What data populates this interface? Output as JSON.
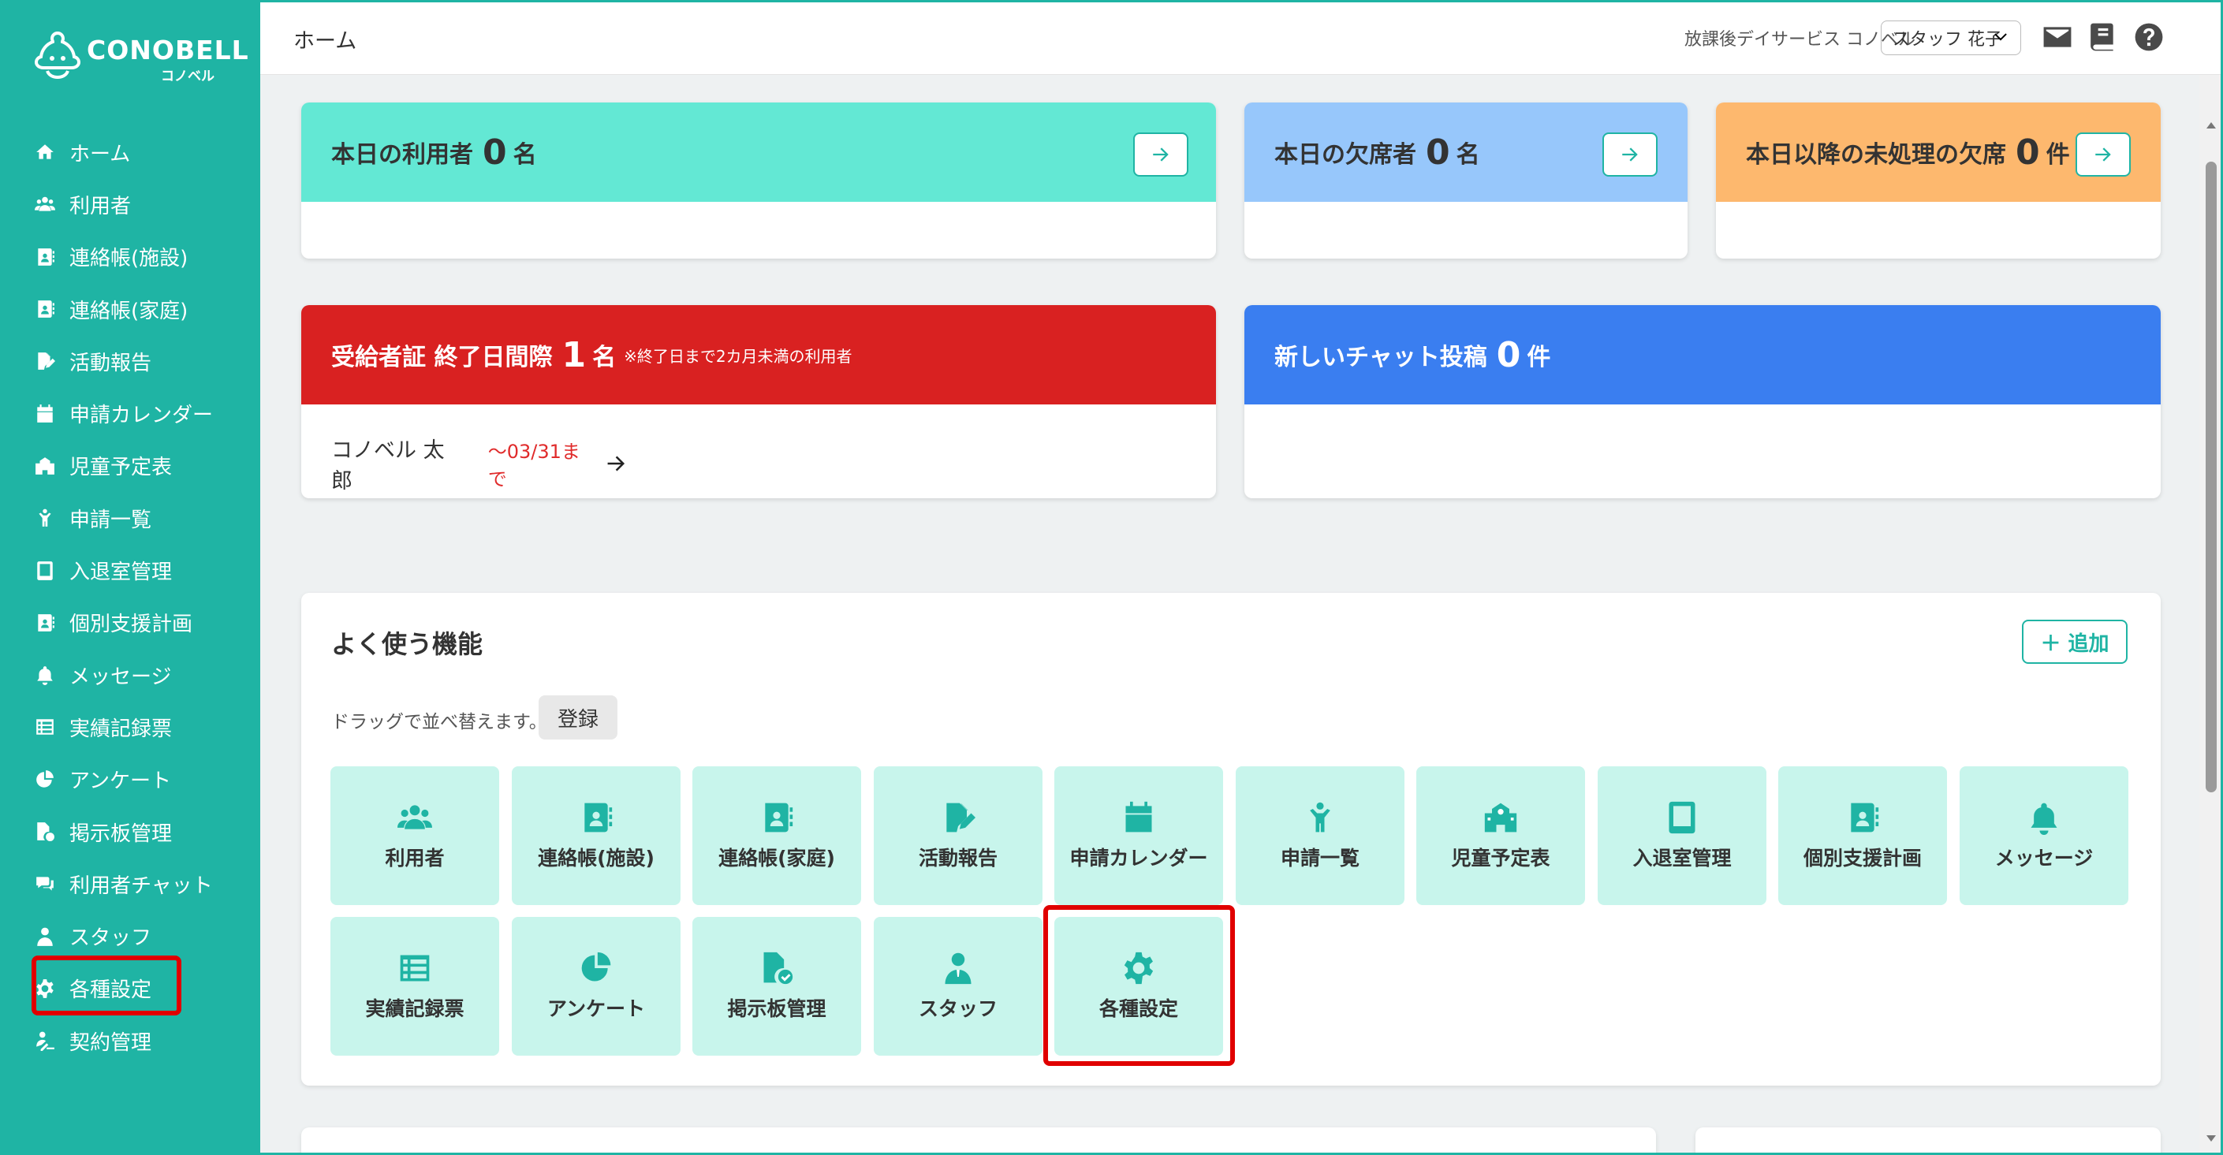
{
  "app": {
    "logo_text": "CONOBELL",
    "logo_sub": "コノベル"
  },
  "sidebar": {
    "items": [
      {
        "label": "ホーム",
        "icon": "home-icon"
      },
      {
        "label": "利用者",
        "icon": "users-icon"
      },
      {
        "label": "連絡帳(施設)",
        "icon": "contact-book-icon"
      },
      {
        "label": "連絡帳(家庭)",
        "icon": "contact-book-icon"
      },
      {
        "label": "活動報告",
        "icon": "file-pen-icon"
      },
      {
        "label": "申請カレンダー",
        "icon": "calendar-icon"
      },
      {
        "label": "児童予定表",
        "icon": "school-icon"
      },
      {
        "label": "申請一覧",
        "icon": "child-icon"
      },
      {
        "label": "入退室管理",
        "icon": "tablet-icon"
      },
      {
        "label": "個別支援計画",
        "icon": "contact-book-icon"
      },
      {
        "label": "メッセージ",
        "icon": "bell-icon"
      },
      {
        "label": "実績記録票",
        "icon": "table-list-icon"
      },
      {
        "label": "アンケート",
        "icon": "pie-chart-icon"
      },
      {
        "label": "掲示板管理",
        "icon": "file-check-icon"
      },
      {
        "label": "利用者チャット",
        "icon": "chat-icon"
      },
      {
        "label": "スタッフ",
        "icon": "staff-icon"
      },
      {
        "label": "各種設定",
        "icon": "gear-icon"
      },
      {
        "label": "契約管理",
        "icon": "contract-icon"
      }
    ]
  },
  "header": {
    "title": "ホーム",
    "facility": "放課後デイサービス コノベル",
    "staff_selected": "スタッフ 花子"
  },
  "summary": {
    "today_users": {
      "label": "本日の利用者",
      "count": "0",
      "unit": "名"
    },
    "today_absent": {
      "label": "本日の欠席者",
      "count": "0",
      "unit": "名"
    },
    "unprocessed_absent": {
      "label": "本日以降の未処理の欠席",
      "count": "0",
      "unit": "件"
    },
    "certificate": {
      "label": "受給者証 終了日間際",
      "count": "1",
      "unit": "名",
      "note": "※終了日まで2カ月未満の利用者",
      "user_name": "コノベル 太郎",
      "until": "〜03/31まで"
    },
    "chat": {
      "label": "新しいチャット投稿",
      "count": "0",
      "unit": "件"
    }
  },
  "favorites": {
    "title": "よく使う機能",
    "add_label": "＋ 追加",
    "hint": "ドラッグで並べ替えます。",
    "register_label": "登録",
    "tiles": [
      {
        "label": "利用者",
        "icon": "users-icon"
      },
      {
        "label": "連絡帳(施設)",
        "icon": "contact-book-icon"
      },
      {
        "label": "連絡帳(家庭)",
        "icon": "contact-book-icon"
      },
      {
        "label": "活動報告",
        "icon": "file-pen-icon"
      },
      {
        "label": "申請カレンダー",
        "icon": "calendar-icon"
      },
      {
        "label": "申請一覧",
        "icon": "child-icon"
      },
      {
        "label": "児童予定表",
        "icon": "school-icon"
      },
      {
        "label": "入退室管理",
        "icon": "tablet-icon"
      },
      {
        "label": "個別支援計画",
        "icon": "contact-book-icon"
      },
      {
        "label": "メッセージ",
        "icon": "bell-icon"
      },
      {
        "label": "実績記録票",
        "icon": "table-list-icon"
      },
      {
        "label": "アンケート",
        "icon": "pie-chart-icon"
      },
      {
        "label": "掲示板管理",
        "icon": "file-check-icon"
      },
      {
        "label": "スタッフ",
        "icon": "staff-icon"
      },
      {
        "label": "各種設定",
        "icon": "gear-icon"
      }
    ]
  },
  "colors": {
    "brand": "#1fb4a4",
    "today_users_bg": "#63e8d4",
    "today_absent_bg": "#97c7fb",
    "unprocessed_bg": "#fdb86e",
    "certificate_bg": "#d92121",
    "chat_bg": "#3a7ef0",
    "tile_bg": "#c8f5ec",
    "highlight": "#e00000"
  }
}
